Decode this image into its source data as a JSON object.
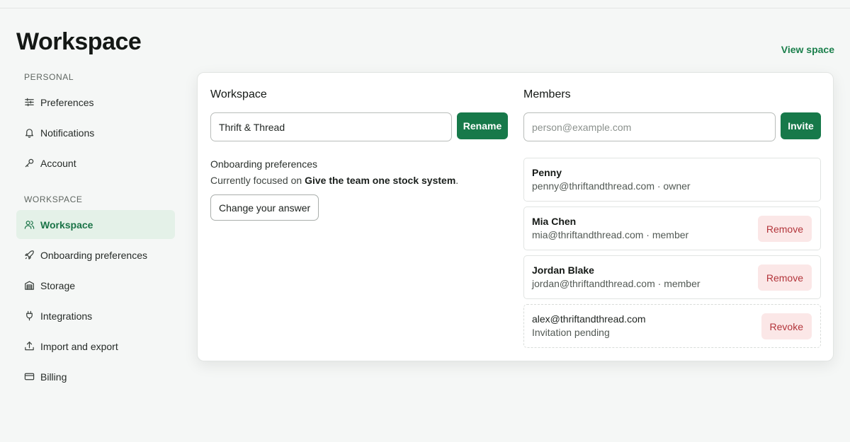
{
  "page": {
    "title": "Workspace",
    "view_space_label": "View space"
  },
  "sidebar": {
    "personal_heading": "PERSONAL",
    "workspace_heading": "WORKSPACE",
    "items": [
      {
        "label": "Preferences",
        "icon": "sliders-icon"
      },
      {
        "label": "Notifications",
        "icon": "bell-icon"
      },
      {
        "label": "Account",
        "icon": "key-icon"
      },
      {
        "label": "Workspace",
        "icon": "users-icon",
        "active": true
      },
      {
        "label": "Onboarding preferences",
        "icon": "rocket-icon"
      },
      {
        "label": "Storage",
        "icon": "warehouse-icon"
      },
      {
        "label": "Integrations",
        "icon": "plug-icon"
      },
      {
        "label": "Import and export",
        "icon": "upload-icon"
      },
      {
        "label": "Billing",
        "icon": "credit-card-icon"
      }
    ]
  },
  "workspace_panel": {
    "heading": "Workspace",
    "name_value": "Thrift & Thread",
    "rename_label": "Rename",
    "onboarding_heading": "Onboarding preferences",
    "focus_prefix": "Currently focused on ",
    "focus_value": "Give the team one stock system",
    "focus_suffix": ".",
    "change_answer_label": "Change your answer"
  },
  "members_panel": {
    "heading": "Members",
    "invite_placeholder": "person@example.com",
    "invite_label": "Invite",
    "members": [
      {
        "name": "Penny",
        "detail": "penny@thriftandthread.com · owner"
      },
      {
        "name": "Mia Chen",
        "detail": "mia@thriftandthread.com · member",
        "action": "Remove"
      },
      {
        "name": "Jordan Blake",
        "detail": "jordan@thriftandthread.com · member",
        "action": "Remove"
      },
      {
        "name": "alex@thriftandthread.com",
        "detail": "Invitation pending",
        "action": "Revoke",
        "pending": true
      }
    ]
  },
  "colors": {
    "accent": "#17794a",
    "active_bg": "#e4f1e8",
    "danger_text": "#b3353b",
    "danger_bg": "#fbe7e7"
  }
}
